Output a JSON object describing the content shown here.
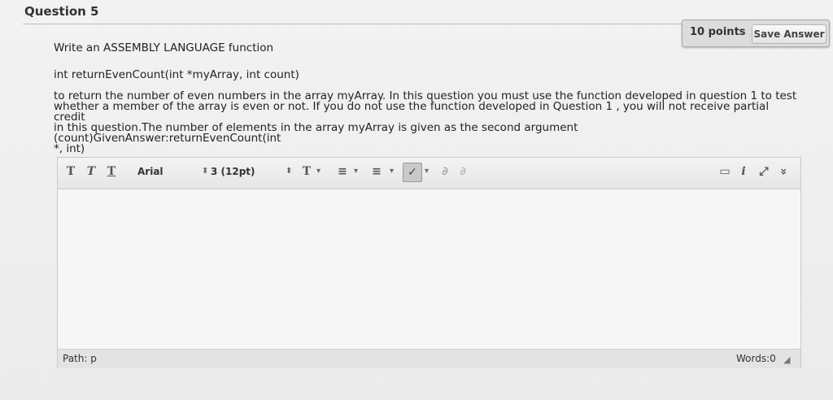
{
  "question": {
    "title": "Question 5",
    "points": "10 points",
    "save_label": "Save Answer",
    "line1": "Write an ASSEMBLY LANGUAGE function",
    "line2": "int returnEvenCount(int *myArray, int count)",
    "para": [
      "to return the number of even numbers in the array myArray. In this question you must use the function developed in question 1 to test",
      "whether a member of the array is even or not. If you do not use the function developed in Question 1 , you will not receive partial credit",
      "in this question.The number of elements in the array myArray is given as the second argument (count)GivenAnswer:returnEvenCount(int",
      "*, int)"
    ]
  },
  "editor": {
    "font_family": "Arial",
    "font_size": "3 (12pt)",
    "path": "Path: p",
    "words": "Words:0"
  },
  "toolbar_icons": {
    "bold": "T",
    "italic": "T",
    "underline": "T",
    "text_color": "T",
    "bullets": "≡",
    "numbering": "≡",
    "spellcheck": "✓",
    "link": "∂",
    "unlink": "∂",
    "preview": "▭",
    "info": "i",
    "fullscreen": "⤢",
    "collapse": "»"
  }
}
